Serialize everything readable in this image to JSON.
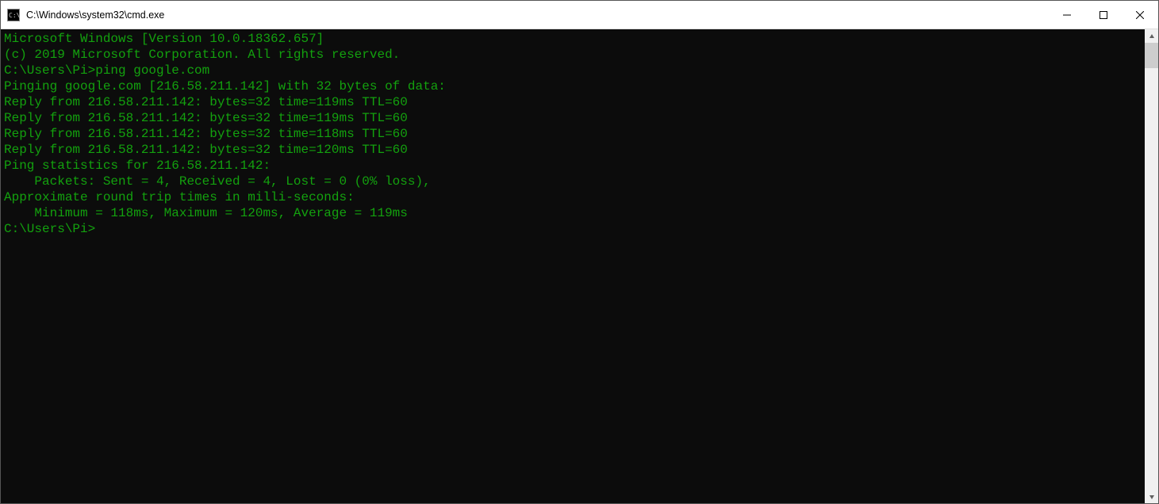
{
  "window": {
    "title": "C:\\Windows\\system32\\cmd.exe"
  },
  "terminal": {
    "lines": {
      "l0": "Microsoft Windows [Version 10.0.18362.657]",
      "l1": "(c) 2019 Microsoft Corporation. All rights reserved.",
      "l2": "",
      "l3": "C:\\Users\\Pi>ping google.com",
      "l4": "",
      "l5": "Pinging google.com [216.58.211.142] with 32 bytes of data:",
      "l6": "Reply from 216.58.211.142: bytes=32 time=119ms TTL=60",
      "l7": "Reply from 216.58.211.142: bytes=32 time=119ms TTL=60",
      "l8": "Reply from 216.58.211.142: bytes=32 time=118ms TTL=60",
      "l9": "Reply from 216.58.211.142: bytes=32 time=120ms TTL=60",
      "l10": "",
      "l11": "Ping statistics for 216.58.211.142:",
      "l12": "    Packets: Sent = 4, Received = 4, Lost = 0 (0% loss),",
      "l13": "Approximate round trip times in milli-seconds:",
      "l14": "    Minimum = 118ms, Maximum = 120ms, Average = 119ms",
      "l15": "",
      "l16": "C:\\Users\\Pi>"
    }
  }
}
